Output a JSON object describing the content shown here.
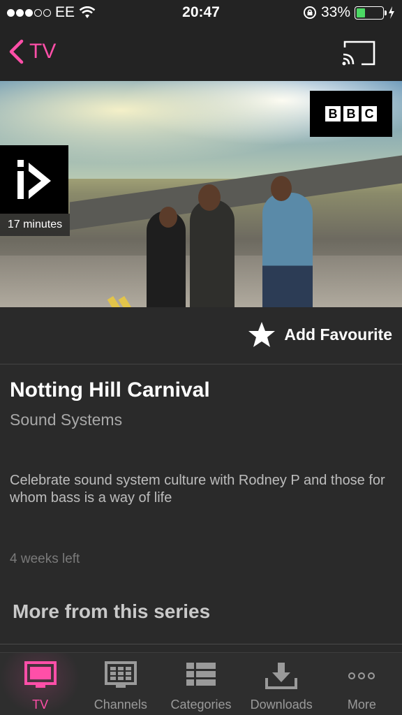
{
  "status_bar": {
    "carrier": "EE",
    "time": "20:47",
    "battery_percent": "33%",
    "battery_level": 0.33
  },
  "nav": {
    "back_label": "TV"
  },
  "hero": {
    "duration": "17 minutes",
    "channel_letters": [
      "B",
      "B",
      "C"
    ]
  },
  "favourite": {
    "label": "Add Favourite"
  },
  "programme": {
    "title": "Notting Hill Carnival",
    "subtitle": "Sound Systems",
    "description": "Celebrate sound system culture with Rodney P and those for whom bass is a way of life",
    "availability": "4 weeks left"
  },
  "more_section": {
    "heading": "More from this series"
  },
  "tabs": [
    {
      "label": "TV",
      "icon": "tv-icon",
      "active": true
    },
    {
      "label": "Channels",
      "icon": "channels-icon",
      "active": false
    },
    {
      "label": "Categories",
      "icon": "categories-icon",
      "active": false
    },
    {
      "label": "Downloads",
      "icon": "downloads-icon",
      "active": false
    },
    {
      "label": "More",
      "icon": "more-icon",
      "active": false
    }
  ],
  "colors": {
    "accent": "#ff4fa8",
    "background": "#2a2a2a",
    "battery": "#4cd964"
  }
}
